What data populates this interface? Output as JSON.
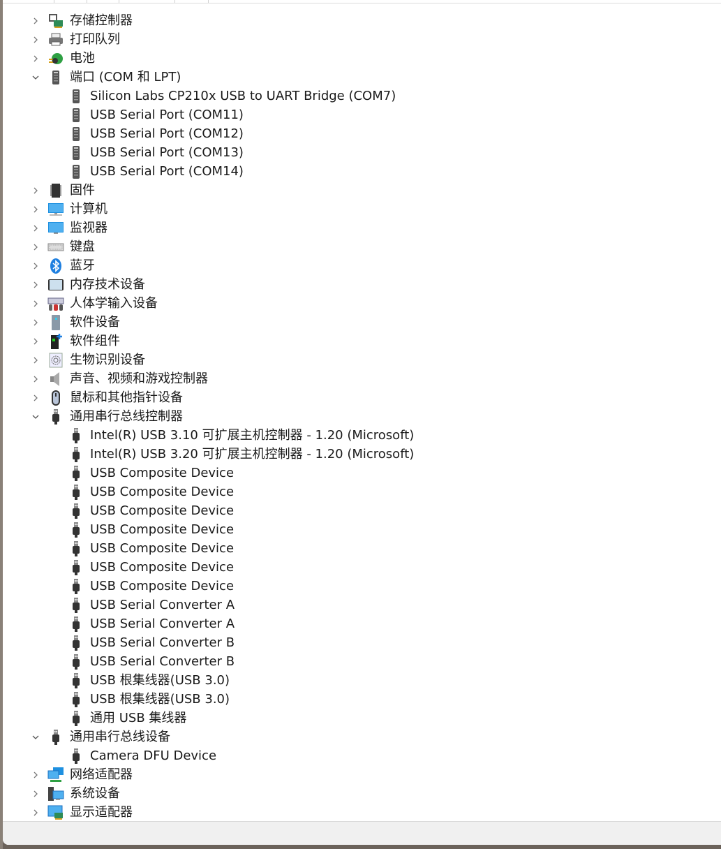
{
  "tree": [
    {
      "label": "存储控制器",
      "level": 0,
      "state": "collapsed",
      "icon": "storage-controller-icon"
    },
    {
      "label": "打印队列",
      "level": 0,
      "state": "collapsed",
      "icon": "printer-icon"
    },
    {
      "label": "电池",
      "level": 0,
      "state": "collapsed",
      "icon": "battery-icon"
    },
    {
      "label": "端口 (COM 和 LPT)",
      "level": 0,
      "state": "expanded",
      "icon": "port-icon"
    },
    {
      "label": "Silicon Labs CP210x USB to UART Bridge (COM7)",
      "level": 1,
      "icon": "port-icon"
    },
    {
      "label": "USB Serial Port (COM11)",
      "level": 1,
      "icon": "port-icon"
    },
    {
      "label": "USB Serial Port (COM12)",
      "level": 1,
      "icon": "port-icon"
    },
    {
      "label": "USB Serial Port (COM13)",
      "level": 1,
      "icon": "port-icon"
    },
    {
      "label": "USB Serial Port (COM14)",
      "level": 1,
      "icon": "port-icon"
    },
    {
      "label": "固件",
      "level": 0,
      "state": "collapsed",
      "icon": "firmware-chip-icon"
    },
    {
      "label": "计算机",
      "level": 0,
      "state": "collapsed",
      "icon": "computer-icon"
    },
    {
      "label": "监视器",
      "level": 0,
      "state": "collapsed",
      "icon": "monitor-icon"
    },
    {
      "label": "键盘",
      "level": 0,
      "state": "collapsed",
      "icon": "keyboard-icon"
    },
    {
      "label": "蓝牙",
      "level": 0,
      "state": "collapsed",
      "icon": "bluetooth-icon"
    },
    {
      "label": "内存技术设备",
      "level": 0,
      "state": "collapsed",
      "icon": "memory-device-icon"
    },
    {
      "label": "人体学输入设备",
      "level": 0,
      "state": "collapsed",
      "icon": "hid-icon"
    },
    {
      "label": "软件设备",
      "level": 0,
      "state": "collapsed",
      "icon": "software-device-icon"
    },
    {
      "label": "软件组件",
      "level": 0,
      "state": "collapsed",
      "icon": "software-component-icon"
    },
    {
      "label": "生物识别设备",
      "level": 0,
      "state": "collapsed",
      "icon": "fingerprint-icon"
    },
    {
      "label": "声音、视频和游戏控制器",
      "level": 0,
      "state": "collapsed",
      "icon": "speaker-icon"
    },
    {
      "label": "鼠标和其他指针设备",
      "level": 0,
      "state": "collapsed",
      "icon": "mouse-icon"
    },
    {
      "label": "通用串行总线控制器",
      "level": 0,
      "state": "expanded",
      "icon": "usb-plug-icon"
    },
    {
      "label": "Intel(R) USB 3.10 可扩展主机控制器 - 1.20 (Microsoft)",
      "level": 1,
      "icon": "usb-plug-icon"
    },
    {
      "label": "Intel(R) USB 3.20 可扩展主机控制器 - 1.20 (Microsoft)",
      "level": 1,
      "icon": "usb-plug-icon"
    },
    {
      "label": "USB Composite Device",
      "level": 1,
      "icon": "usb-plug-icon"
    },
    {
      "label": "USB Composite Device",
      "level": 1,
      "icon": "usb-plug-icon"
    },
    {
      "label": "USB Composite Device",
      "level": 1,
      "icon": "usb-plug-icon"
    },
    {
      "label": "USB Composite Device",
      "level": 1,
      "icon": "usb-plug-icon"
    },
    {
      "label": "USB Composite Device",
      "level": 1,
      "icon": "usb-plug-icon"
    },
    {
      "label": "USB Composite Device",
      "level": 1,
      "icon": "usb-plug-icon"
    },
    {
      "label": "USB Composite Device",
      "level": 1,
      "icon": "usb-plug-icon"
    },
    {
      "label": "USB Serial Converter A",
      "level": 1,
      "icon": "usb-plug-icon"
    },
    {
      "label": "USB Serial Converter A",
      "level": 1,
      "icon": "usb-plug-icon"
    },
    {
      "label": "USB Serial Converter B",
      "level": 1,
      "icon": "usb-plug-icon"
    },
    {
      "label": "USB Serial Converter B",
      "level": 1,
      "icon": "usb-plug-icon"
    },
    {
      "label": "USB 根集线器(USB 3.0)",
      "level": 1,
      "icon": "usb-plug-icon"
    },
    {
      "label": "USB 根集线器(USB 3.0)",
      "level": 1,
      "icon": "usb-plug-icon"
    },
    {
      "label": "通用 USB 集线器",
      "level": 1,
      "icon": "usb-plug-icon"
    },
    {
      "label": "通用串行总线设备",
      "level": 0,
      "state": "expanded",
      "icon": "usb-plug-icon"
    },
    {
      "label": "Camera DFU Device",
      "level": 1,
      "icon": "usb-plug-icon"
    },
    {
      "label": "网络适配器",
      "level": 0,
      "state": "collapsed",
      "icon": "network-adapter-icon"
    },
    {
      "label": "系统设备",
      "level": 0,
      "state": "collapsed",
      "icon": "system-device-icon"
    },
    {
      "label": "显示适配器",
      "level": 0,
      "state": "collapsed",
      "icon": "display-adapter-icon"
    }
  ]
}
